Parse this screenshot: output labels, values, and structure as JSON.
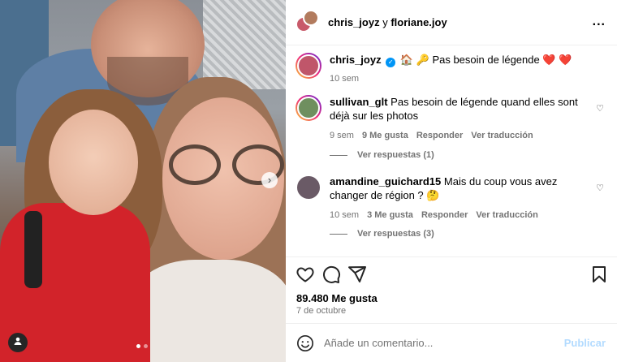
{
  "header": {
    "user1": "chris_joyz",
    "separator": "y",
    "user2": "floriane.joy",
    "more": "..."
  },
  "caption": {
    "username": "chris_joyz",
    "verified_icon": "✓",
    "text": "🏠 🔑 Pas besoin de légende ❤️ ❤️",
    "time": "10 sem"
  },
  "comments": [
    {
      "username": "sullivan_glt",
      "text": "Pas besoin de légende quand elles sont déjà sur les photos",
      "time": "9 sem",
      "likes": "9 Me gusta",
      "reply": "Responder",
      "translate": "Ver traducción",
      "view_replies": "Ver respuestas (1)"
    },
    {
      "username": "amandine_guichard15",
      "text": "Mais du coup vous avez changer de région ? 🤔",
      "time": "10 sem",
      "likes": "3 Me gusta",
      "reply": "Responder",
      "translate": "Ver traducción",
      "view_replies": "Ver respuestas (3)"
    }
  ],
  "post": {
    "likes": "89.480 Me gusta",
    "date": "7 de octubre"
  },
  "composer": {
    "placeholder": "Añade un comentario...",
    "publish": "Publicar"
  },
  "icons": {
    "like": "heart-icon",
    "comment": "comment-icon",
    "share": "share-icon",
    "save": "bookmark-icon",
    "emoji": "emoji-icon",
    "next": "chevron-right-icon",
    "tags": "user-tag-icon"
  },
  "colors": {
    "accent": "#0095f6",
    "publish_disabled": "#b3dbff",
    "secondary_text": "#737373"
  }
}
